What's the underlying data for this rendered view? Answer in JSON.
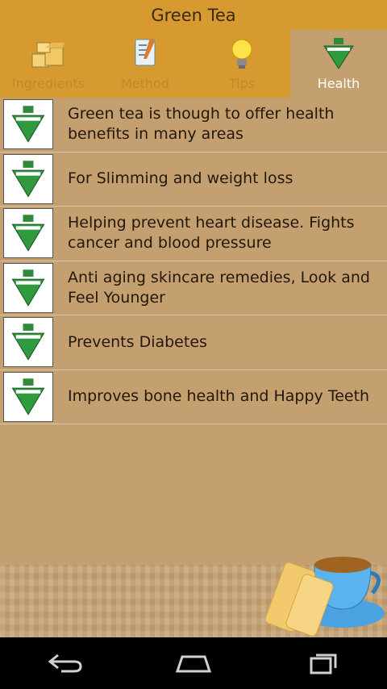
{
  "app": {
    "title": "Green Tea"
  },
  "tabs": [
    {
      "label": "Ingredients",
      "icon": "ingredients-icon",
      "active": false
    },
    {
      "label": "Method",
      "icon": "method-icon",
      "active": false
    },
    {
      "label": "Tips",
      "icon": "lightbulb-icon",
      "active": false
    },
    {
      "label": "Health",
      "icon": "tea-bag-icon",
      "active": true
    }
  ],
  "health_items": [
    {
      "text": "Green tea is though to offer health benefits in many areas"
    },
    {
      "text": "For Slimming and weight loss"
    },
    {
      "text": "Helping prevent heart disease. Fights cancer and blood pressure"
    },
    {
      "text": "Anti aging skincare remedies, Look and Feel Younger"
    },
    {
      "text": "Prevents Diabetes"
    },
    {
      "text": "Improves bone health and Happy Teeth"
    }
  ],
  "colors": {
    "header": "#d69a30",
    "background": "#c4a070",
    "active_tab_text": "#ffffff",
    "inactive_tab_text": "#c08a2c"
  },
  "nav": {
    "back_icon": "back-icon",
    "home_icon": "home-icon",
    "recents_icon": "recent-apps-icon"
  }
}
